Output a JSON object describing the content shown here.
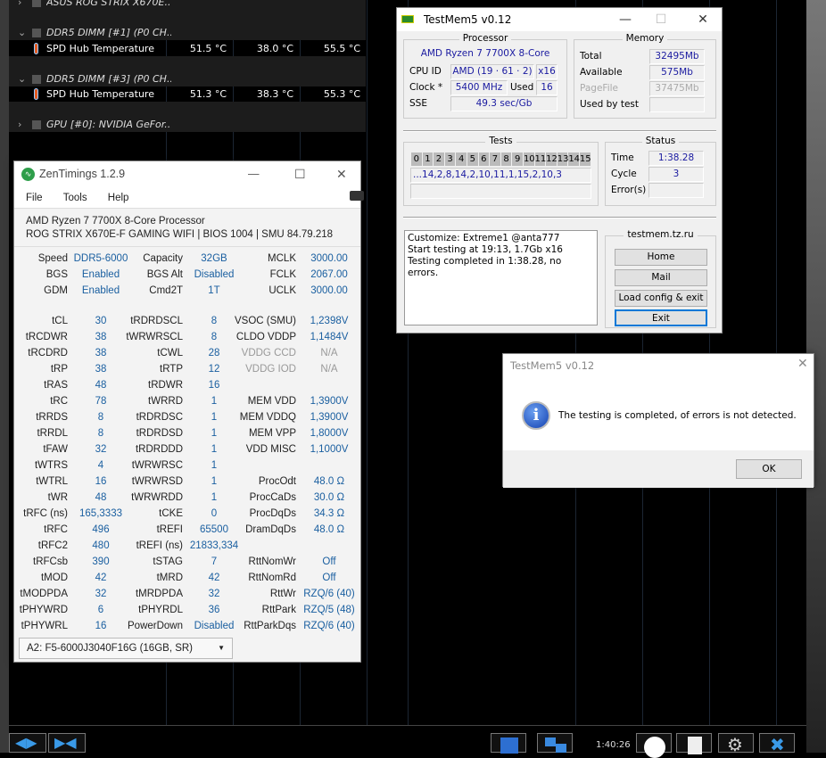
{
  "hwinfo": {
    "rows": [
      {
        "type": "group",
        "name": "ASUS ROG STRIX X670E..."
      },
      {
        "type": "blank"
      },
      {
        "type": "group",
        "name": "DDR5 DIMM [#1] (P0 CH..."
      },
      {
        "type": "sensor",
        "name": "SPD Hub Temperature",
        "current": "51.5 °C",
        "min": "38.0 °C",
        "max": "55.5 °C"
      },
      {
        "type": "blank"
      },
      {
        "type": "group",
        "name": "DDR5 DIMM [#3] (P0 CH..."
      },
      {
        "type": "sensor",
        "name": "SPD Hub Temperature",
        "current": "51.3 °C",
        "min": "38.3 °C",
        "max": "55.3 °C"
      },
      {
        "type": "blank"
      },
      {
        "type": "group",
        "name": "GPU [#0]: NVIDIA GeFor..."
      }
    ],
    "clock": "1:40:26"
  },
  "zentimings": {
    "title": "ZenTimings 1.2.9",
    "menu": [
      "File",
      "Tools",
      "Help"
    ],
    "cpu": "AMD Ryzen 7 7700X 8-Core Processor",
    "board": "ROG STRIX X670E-F GAMING WIFI | BIOS 1004 | SMU 84.79.218",
    "rows": [
      [
        [
          "Speed",
          "DDR5-6000"
        ],
        [
          "Capacity",
          "32GB"
        ],
        [
          "MCLK",
          "3000.00"
        ]
      ],
      [
        [
          "BGS",
          "Enabled"
        ],
        [
          "BGS Alt",
          "Disabled"
        ],
        [
          "FCLK",
          "2067.00"
        ]
      ],
      [
        [
          "GDM",
          "Enabled"
        ],
        [
          "Cmd2T",
          "1T"
        ],
        [
          "UCLK",
          "3000.00"
        ]
      ],
      null,
      [
        [
          "tCL",
          "30"
        ],
        [
          "tRDRDSCL",
          "8"
        ],
        [
          "VSOC (SMU)",
          "1,2398V"
        ]
      ],
      [
        [
          "tRCDWR",
          "38"
        ],
        [
          "tWRWRSCL",
          "8"
        ],
        [
          "CLDO VDDP",
          "1,1484V"
        ]
      ],
      [
        [
          "tRCDRD",
          "38"
        ],
        [
          "tCWL",
          "28"
        ],
        [
          "VDDG CCD",
          "N/A"
        ]
      ],
      [
        [
          "tRP",
          "38"
        ],
        [
          "tRTP",
          "12"
        ],
        [
          "VDDG IOD",
          "N/A"
        ]
      ],
      [
        [
          "tRAS",
          "48"
        ],
        [
          "tRDWR",
          "16"
        ],
        [
          "",
          ""
        ]
      ],
      [
        [
          "tRC",
          "78"
        ],
        [
          "tWRRD",
          "1"
        ],
        [
          "MEM VDD",
          "1,3900V"
        ]
      ],
      [
        [
          "tRRDS",
          "8"
        ],
        [
          "tRDRDSC",
          "1"
        ],
        [
          "MEM VDDQ",
          "1,3900V"
        ]
      ],
      [
        [
          "tRRDL",
          "8"
        ],
        [
          "tRDRDSD",
          "1"
        ],
        [
          "MEM VPP",
          "1,8000V"
        ]
      ],
      [
        [
          "tFAW",
          "32"
        ],
        [
          "tRDRDDD",
          "1"
        ],
        [
          "VDD MISC",
          "1,1000V"
        ]
      ],
      [
        [
          "tWTRS",
          "4"
        ],
        [
          "tWRWRSC",
          "1"
        ],
        [
          "",
          ""
        ]
      ],
      [
        [
          "tWTRL",
          "16"
        ],
        [
          "tWRWRSD",
          "1"
        ],
        [
          "ProcOdt",
          "48.0 Ω"
        ]
      ],
      [
        [
          "tWR",
          "48"
        ],
        [
          "tWRWRDD",
          "1"
        ],
        [
          "ProcCaDs",
          "30.0 Ω"
        ]
      ],
      [
        [
          "tRFC (ns)",
          "165,3333"
        ],
        [
          "tCKE",
          "0"
        ],
        [
          "ProcDqDs",
          "34.3 Ω"
        ]
      ],
      [
        [
          "tRFC",
          "496"
        ],
        [
          "tREFI",
          "65500"
        ],
        [
          "DramDqDs",
          "48.0 Ω"
        ]
      ],
      [
        [
          "tRFC2",
          "480"
        ],
        [
          "tREFI (ns)",
          "21833,334"
        ],
        [
          "",
          ""
        ]
      ],
      [
        [
          "tRFCsb",
          "390"
        ],
        [
          "tSTAG",
          "7"
        ],
        [
          "RttNomWr",
          "Off"
        ]
      ],
      [
        [
          "tMOD",
          "42"
        ],
        [
          "tMRD",
          "42"
        ],
        [
          "RttNomRd",
          "Off"
        ]
      ],
      [
        [
          "tMODPDA",
          "32"
        ],
        [
          "tMRDPDA",
          "32"
        ],
        [
          "RttWr",
          "RZQ/6 (40)"
        ]
      ],
      [
        [
          "tPHYWRD",
          "6"
        ],
        [
          "tPHYRDL",
          "36"
        ],
        [
          "RttPark",
          "RZQ/5 (48)"
        ]
      ],
      [
        [
          "tPHYWRL",
          "16"
        ],
        [
          "PowerDown",
          "Disabled"
        ],
        [
          "RttParkDqs",
          "RZQ/6 (40)"
        ]
      ]
    ],
    "module": "A2: F5-6000J3040F16G (16GB, SR)"
  },
  "testmem": {
    "title": "TestMem5 v0.12",
    "processor": {
      "caption": "Processor",
      "name": "AMD Ryzen 7 7700X 8-Core",
      "cpuid_label": "CPU ID",
      "cpuid": "AMD  (19 · 61 · 2)",
      "threads": "x16",
      "clock_label": "Clock *",
      "clock": "5400 MHz",
      "used_label": "Used",
      "used": "16",
      "sse_label": "SSE",
      "sse": "49.3 sec/Gb"
    },
    "memory": {
      "caption": "Memory",
      "total_label": "Total",
      "total": "32495Mb",
      "available_label": "Available",
      "available": "575Mb",
      "pagefile_label": "PageFile",
      "pagefile": "37475Mb",
      "usedby_label": "Used by test",
      "usedby": ""
    },
    "tests": {
      "caption": "Tests",
      "numbers": [
        "0",
        "1",
        "2",
        "3",
        "4",
        "5",
        "6",
        "7",
        "8",
        "9",
        "10",
        "11",
        "12",
        "13",
        "14",
        "15"
      ],
      "sequence": "...14,2,8,14,2,10,11,1,15,2,10,3"
    },
    "status": {
      "caption": "Status",
      "time_label": "Time",
      "time": "1:38.28",
      "cycle_label": "Cycle",
      "cycle": "3",
      "errors_label": "Error(s)",
      "errors": ""
    },
    "log": [
      "Customize: Extreme1 @anta777",
      "Start testing at 19:13, 1.7Gb x16",
      "Testing completed in 1:38.28, no errors."
    ],
    "links": {
      "caption": "testmem.tz.ru",
      "home": "Home",
      "mail": "Mail",
      "load": "Load config & exit",
      "exit": "Exit"
    }
  },
  "dialog": {
    "title": "TestMem5 v0.12",
    "message": "The testing is completed, of errors is not detected.",
    "ok": "OK"
  }
}
